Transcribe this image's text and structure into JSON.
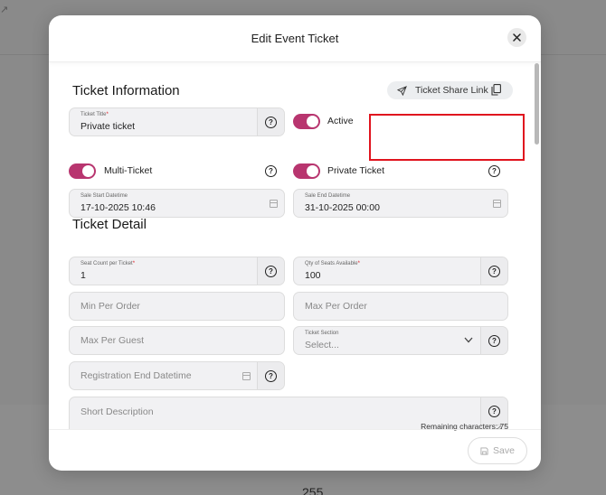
{
  "background": {
    "corner_icon": "external-link-icon",
    "number": "255"
  },
  "modal": {
    "title": "Edit Event Ticket",
    "close_icon": "close-icon"
  },
  "ticket_information": {
    "section_title": "Ticket Information",
    "share_link_label": "Ticket Share Link",
    "ticket_title": {
      "label": "Ticket Title",
      "value": "Private ticket"
    },
    "active_label": "Active",
    "active_on": true,
    "multi_ticket_label": "Multi-Ticket",
    "multi_ticket_on": true,
    "private_ticket_label": "Private Ticket",
    "private_ticket_on": true,
    "sale_start": {
      "label": "Sale Start Datetime",
      "value": "17-10-2025 10:46"
    },
    "sale_end": {
      "label": "Sale End Datetime",
      "value": "31-10-2025 00:00"
    }
  },
  "ticket_detail": {
    "section_title": "Ticket Detail",
    "seat_count": {
      "label": "Seat Count per Ticket",
      "value": "1"
    },
    "qty_seats": {
      "label": "Qty of Seats Available",
      "value": "100"
    },
    "min_per_order_placeholder": "Min Per Order",
    "max_per_order_placeholder": "Max Per Order",
    "max_per_guest_placeholder": "Max Per Guest",
    "ticket_section": {
      "label": "Ticket Section",
      "placeholder": "Select..."
    },
    "registration_end_placeholder": "Registration End Datetime",
    "short_description_placeholder": "Short Description",
    "remaining_characters": "Remaining characters: 75"
  },
  "footer": {
    "save_label": "Save"
  },
  "colors": {
    "toggle_accent": "#b8356f",
    "highlight": "#e0141e"
  }
}
